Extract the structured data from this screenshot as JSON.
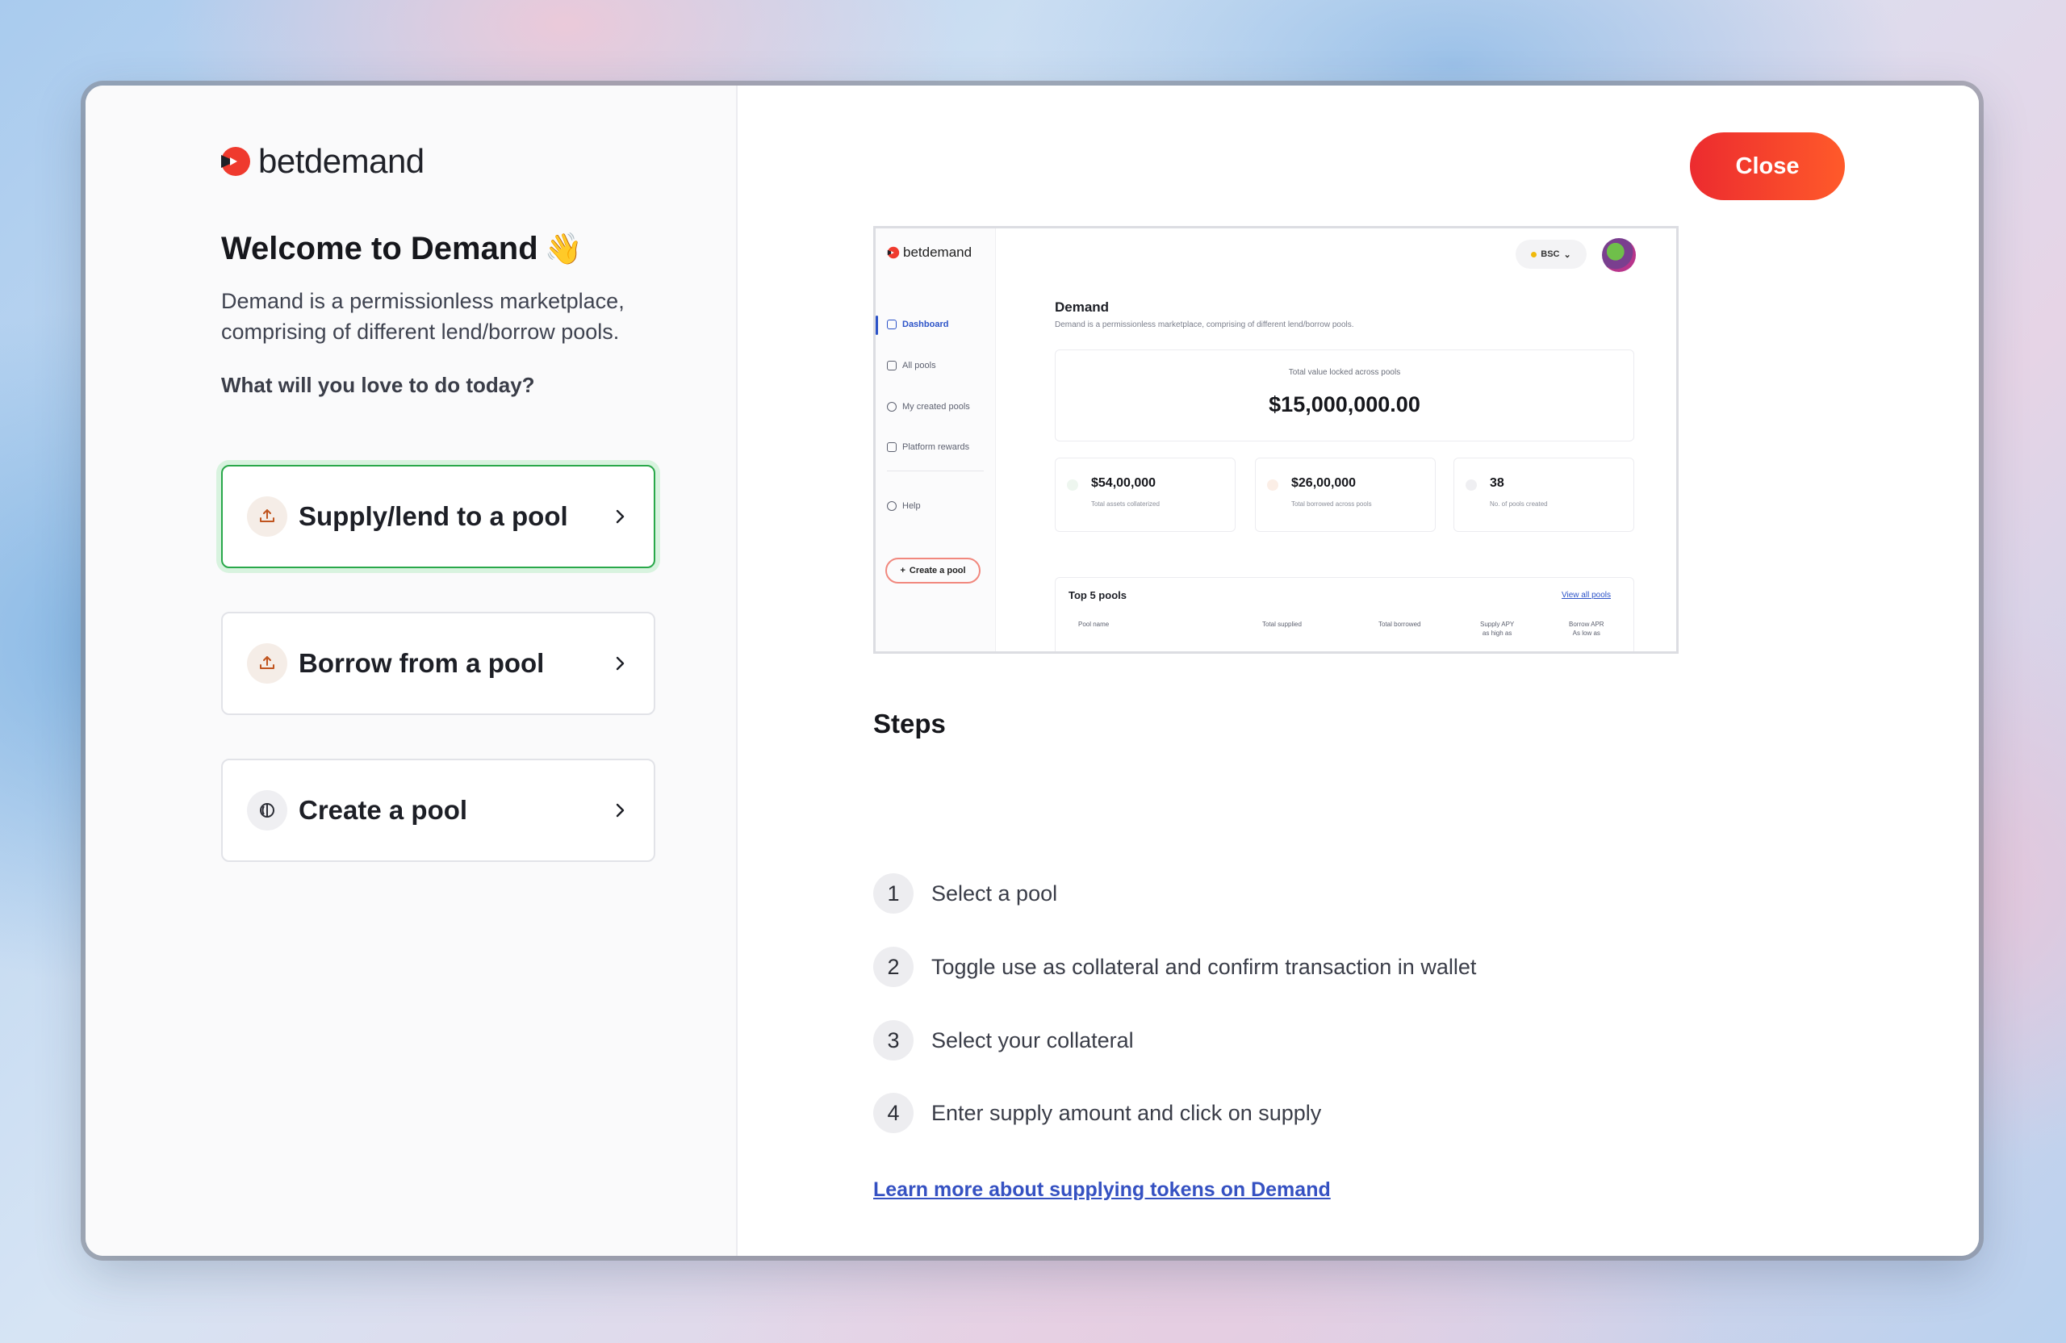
{
  "brand": {
    "name": "betdemand",
    "accent": "#ef3a2e"
  },
  "welcome": {
    "title": "Welcome to Demand",
    "emoji": "👋",
    "description": "Demand is a permissionless marketplace, comprising of different lend/borrow pools.",
    "question": "What will you love to do today?"
  },
  "options": [
    {
      "label": "Supply/lend to a pool",
      "icon": "upload-tray-icon",
      "selected": true
    },
    {
      "label": "Borrow from a pool",
      "icon": "upload-tray-icon",
      "selected": false
    },
    {
      "label": "Create a pool",
      "icon": "pool-icon",
      "selected": false
    }
  ],
  "close_label": "Close",
  "preview": {
    "brand": "betdemand",
    "nav": [
      "Dashboard",
      "All pools",
      "My created pools",
      "Platform rewards",
      "Help"
    ],
    "create_label": "Create a pool",
    "network": "BSC",
    "title": "Demand",
    "subtitle": "Demand is a permissionless marketplace, comprising of different lend/borrow pools.",
    "tvl_label": "Total value locked across pools",
    "tvl_value": "$15,000,000.00",
    "stats": [
      {
        "value": "$54,00,000",
        "label": "Total assets collaterized"
      },
      {
        "value": "$26,00,000",
        "label": "Total borrowed across pools"
      },
      {
        "value": "38",
        "label": "No. of pools created"
      }
    ],
    "top_pools_title": "Top 5 pools",
    "view_all": "View all pools",
    "columns": [
      "Pool name",
      "Total supplied",
      "Total borrowed",
      "Supply APY",
      "Borrow APR"
    ],
    "column_subs": [
      "",
      "",
      "",
      "as high as",
      "As low as"
    ]
  },
  "steps": {
    "title": "Steps",
    "items": [
      {
        "num": "1",
        "text": "Select a pool"
      },
      {
        "num": "2",
        "text": "Toggle use as collateral and confirm transaction in wallet"
      },
      {
        "num": "3",
        "text": "Select your collateral"
      },
      {
        "num": "4",
        "text": "Enter supply amount and click on supply"
      }
    ]
  },
  "learn_more": "Learn more about supplying tokens on Demand"
}
